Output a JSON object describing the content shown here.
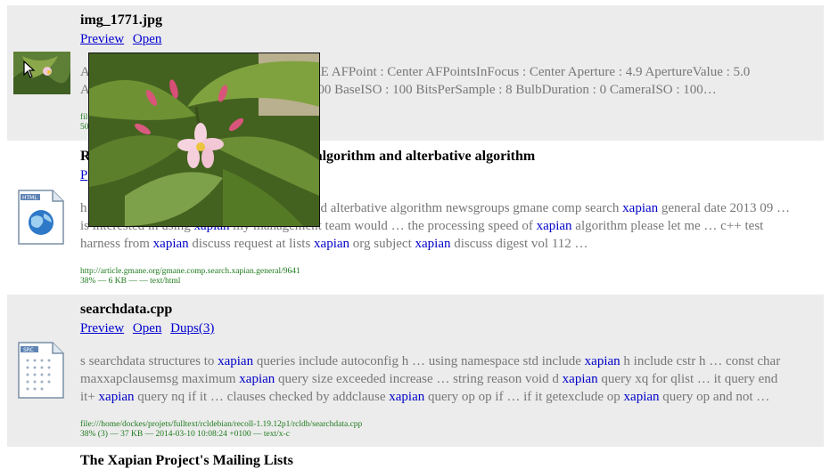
{
  "results": [
    {
      "title": "img_1771.jpg",
      "links": {
        "preview": "Preview",
        "open": "Open"
      },
      "abstract_left_line1": "A",
      "abstract_line1": "AE AFPoint : Center AFPointsInFocus : Center Aperture : 4.9 ApertureValue : 5.0",
      "abstract_left_line2": "A",
      "abstract_line2": "100 BaseISO : 100 BitsPerSample : 8 BulbDuration : 0 CameraISO : 100…",
      "meta_fragment1": "fil",
      "meta_fragment2": "50"
    },
    {
      "title_visible": "algorithm and alterbative algorithm",
      "title_initial": "R",
      "links": {
        "preview_fragment": "P"
      },
      "abs_l1_start": "h",
      "abs_l1_pre": "d alterbative algorithm newsgroups gmane comp search ",
      "abs_l1_mid": " general date 2013 09 …",
      "abs_l2_start": "is interested in using ",
      "abs_l2_mid": " my management team would … the processing speed of ",
      "abs_l2_end": " algorithm please let me … c++ test",
      "abs_l3_pre": "harness from ",
      "abs_l3_mid1": " discuss request at lists ",
      "abs_l3_mid2": " org subject ",
      "abs_l3_end": " discuss digest vol 112 …",
      "url": "http://article.gmane.org/gmane.comp.search.xapian.general/9641",
      "info": "38% — 6 KB — — text/html"
    },
    {
      "title": "searchdata.cpp",
      "links": {
        "preview": "Preview",
        "open": "Open",
        "dups": "Dups(3)"
      },
      "abs_l1_pre": "s searchdata structures to ",
      "abs_l1_mid": " queries include autoconfig h … using namespace std include ",
      "abs_l1_end": " h include cstr h … const char",
      "abs_l2_pre": "maxxapclausemsg maximum ",
      "abs_l2_mid": " query size exceeded increase … string reason void d ",
      "abs_l2_end": " query xq for qlist … it query end",
      "abs_l3_pre": "it+ ",
      "abs_l3_mid": " query nq if it … clauses checked by addclause ",
      "abs_l3_mid2": " query op op if … if it getexclude op ",
      "abs_l3_end": " query op and not …",
      "url": "file:///home/dockes/projets/fulltext/rcldebian/recoll-1.19.12p1/rcldb/searchdata.cpp",
      "info": "38% (3) — 37 KB — 2014-03-10 10:08:24 +0100 — text/x-c"
    },
    {
      "title_partial": "The Xapian Project's Mailing Lists"
    }
  ],
  "highlight_term": "xapian",
  "icons": {
    "html_doc": "html-document-icon",
    "src_doc": "source-document-icon",
    "image_thumb": "plant-photo-thumbnail"
  }
}
